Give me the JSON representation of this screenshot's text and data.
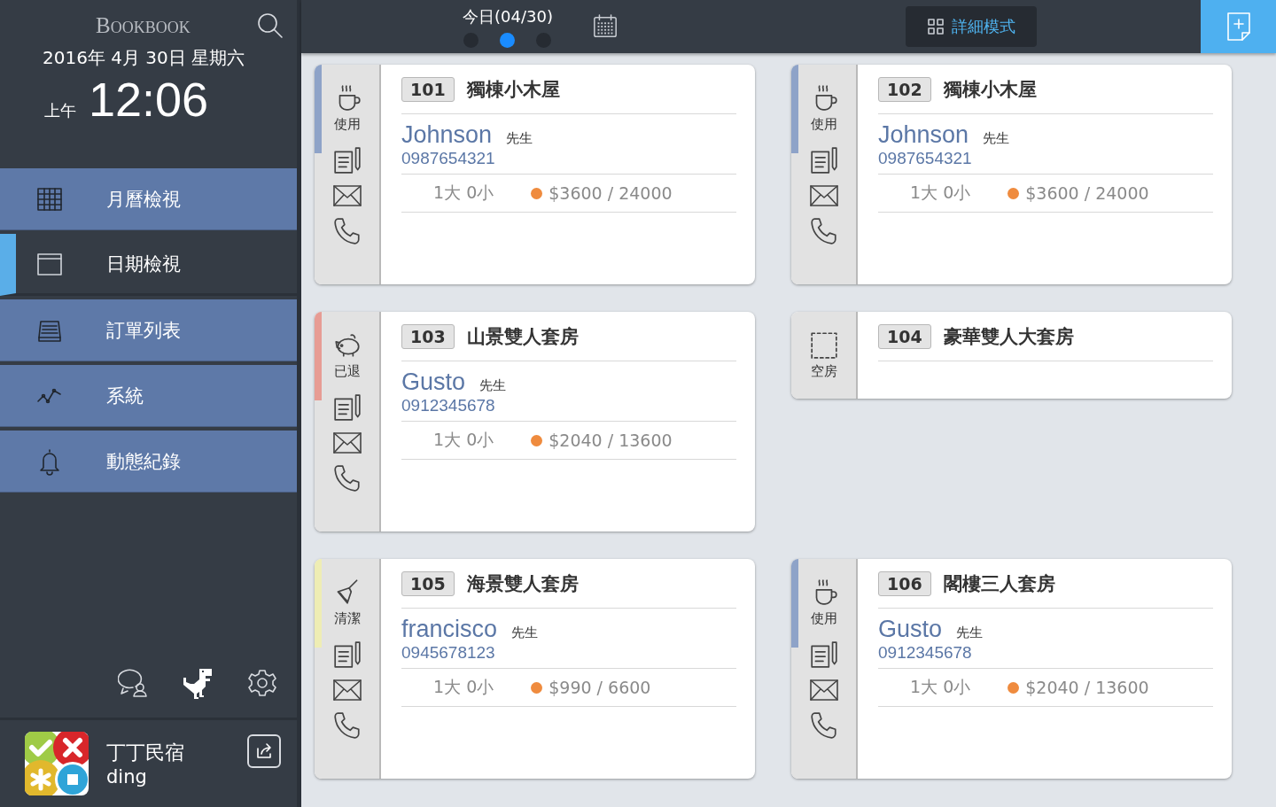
{
  "sidebar": {
    "brand": "Bookbook",
    "date": "2016年 4月 30日 星期六",
    "ampm": "上午",
    "time": "12:06",
    "nav": [
      {
        "label": "月曆檢視",
        "selected": false
      },
      {
        "label": "日期檢視",
        "selected": true
      },
      {
        "label": "訂單列表",
        "selected": false
      },
      {
        "label": "系統",
        "selected": false
      },
      {
        "label": "動態紀錄",
        "selected": false
      }
    ],
    "account": {
      "name": "丁丁民宿",
      "user": "ding"
    }
  },
  "topbar": {
    "today": "今日(04/30)",
    "pages": [
      {
        "selected": false
      },
      {
        "selected": true
      },
      {
        "selected": false
      }
    ],
    "mode_button": "詳細模式"
  },
  "rooms": [
    {
      "number": "101",
      "name": "獨棟小木屋",
      "status": {
        "kind": "in_use",
        "label": "使用"
      },
      "guest": {
        "name": "Johnson",
        "title": "先生",
        "phone": "0987654321"
      },
      "people": "1大 0小",
      "price": "$3600 / 24000"
    },
    {
      "number": "102",
      "name": "獨棟小木屋",
      "status": {
        "kind": "in_use",
        "label": "使用"
      },
      "guest": {
        "name": "Johnson",
        "title": "先生",
        "phone": "0987654321"
      },
      "people": "1大 0小",
      "price": "$3600 / 24000"
    },
    {
      "number": "103",
      "name": "山景雙人套房",
      "status": {
        "kind": "checked_out",
        "label": "已退"
      },
      "guest": {
        "name": "Gusto",
        "title": "先生",
        "phone": "0912345678"
      },
      "people": "1大 0小",
      "price": "$2040 / 13600"
    },
    {
      "number": "104",
      "name": "豪華雙人大套房",
      "status": {
        "kind": "vacant",
        "label": "空房"
      }
    },
    {
      "number": "105",
      "name": "海景雙人套房",
      "status": {
        "kind": "cleaning",
        "label": "清潔"
      },
      "guest": {
        "name": "francisco",
        "title": "先生",
        "phone": "0945678123"
      },
      "people": "1大 0小",
      "price": "$990 / 6600"
    },
    {
      "number": "106",
      "name": "閣樓三人套房",
      "status": {
        "kind": "in_use",
        "label": "使用"
      },
      "guest": {
        "name": "Gusto",
        "title": "先生",
        "phone": "0912345678"
      },
      "people": "1大 0小",
      "price": "$2040 / 13600"
    }
  ]
}
